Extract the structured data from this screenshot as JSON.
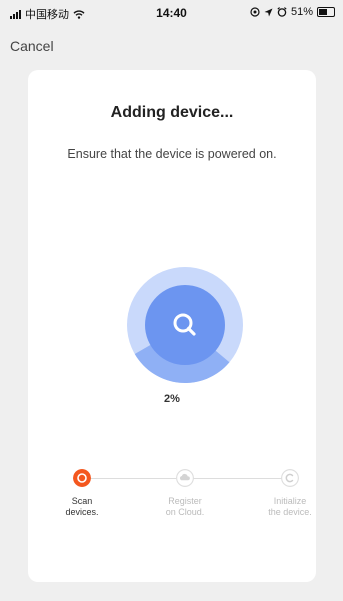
{
  "status_bar": {
    "carrier": "中国移动",
    "time": "14:40",
    "battery": "51%"
  },
  "nav": {
    "cancel_label": "Cancel"
  },
  "card": {
    "title": "Adding device...",
    "subtitle": "Ensure that the device is powered on.",
    "progress_percent": 2,
    "progress_label": "2%"
  },
  "steps": [
    {
      "label_line1": "Scan",
      "label_line2": "devices.",
      "state": "active"
    },
    {
      "label_line1": "Register",
      "label_line2": "on Cloud.",
      "state": "pending"
    },
    {
      "label_line1": "Initialize",
      "label_line2": "the device.",
      "state": "pending"
    }
  ],
  "colors": {
    "accent_orange": "#f4571e",
    "loader_blue": "#6c95f0",
    "loader_light": "#c9d9fb"
  }
}
